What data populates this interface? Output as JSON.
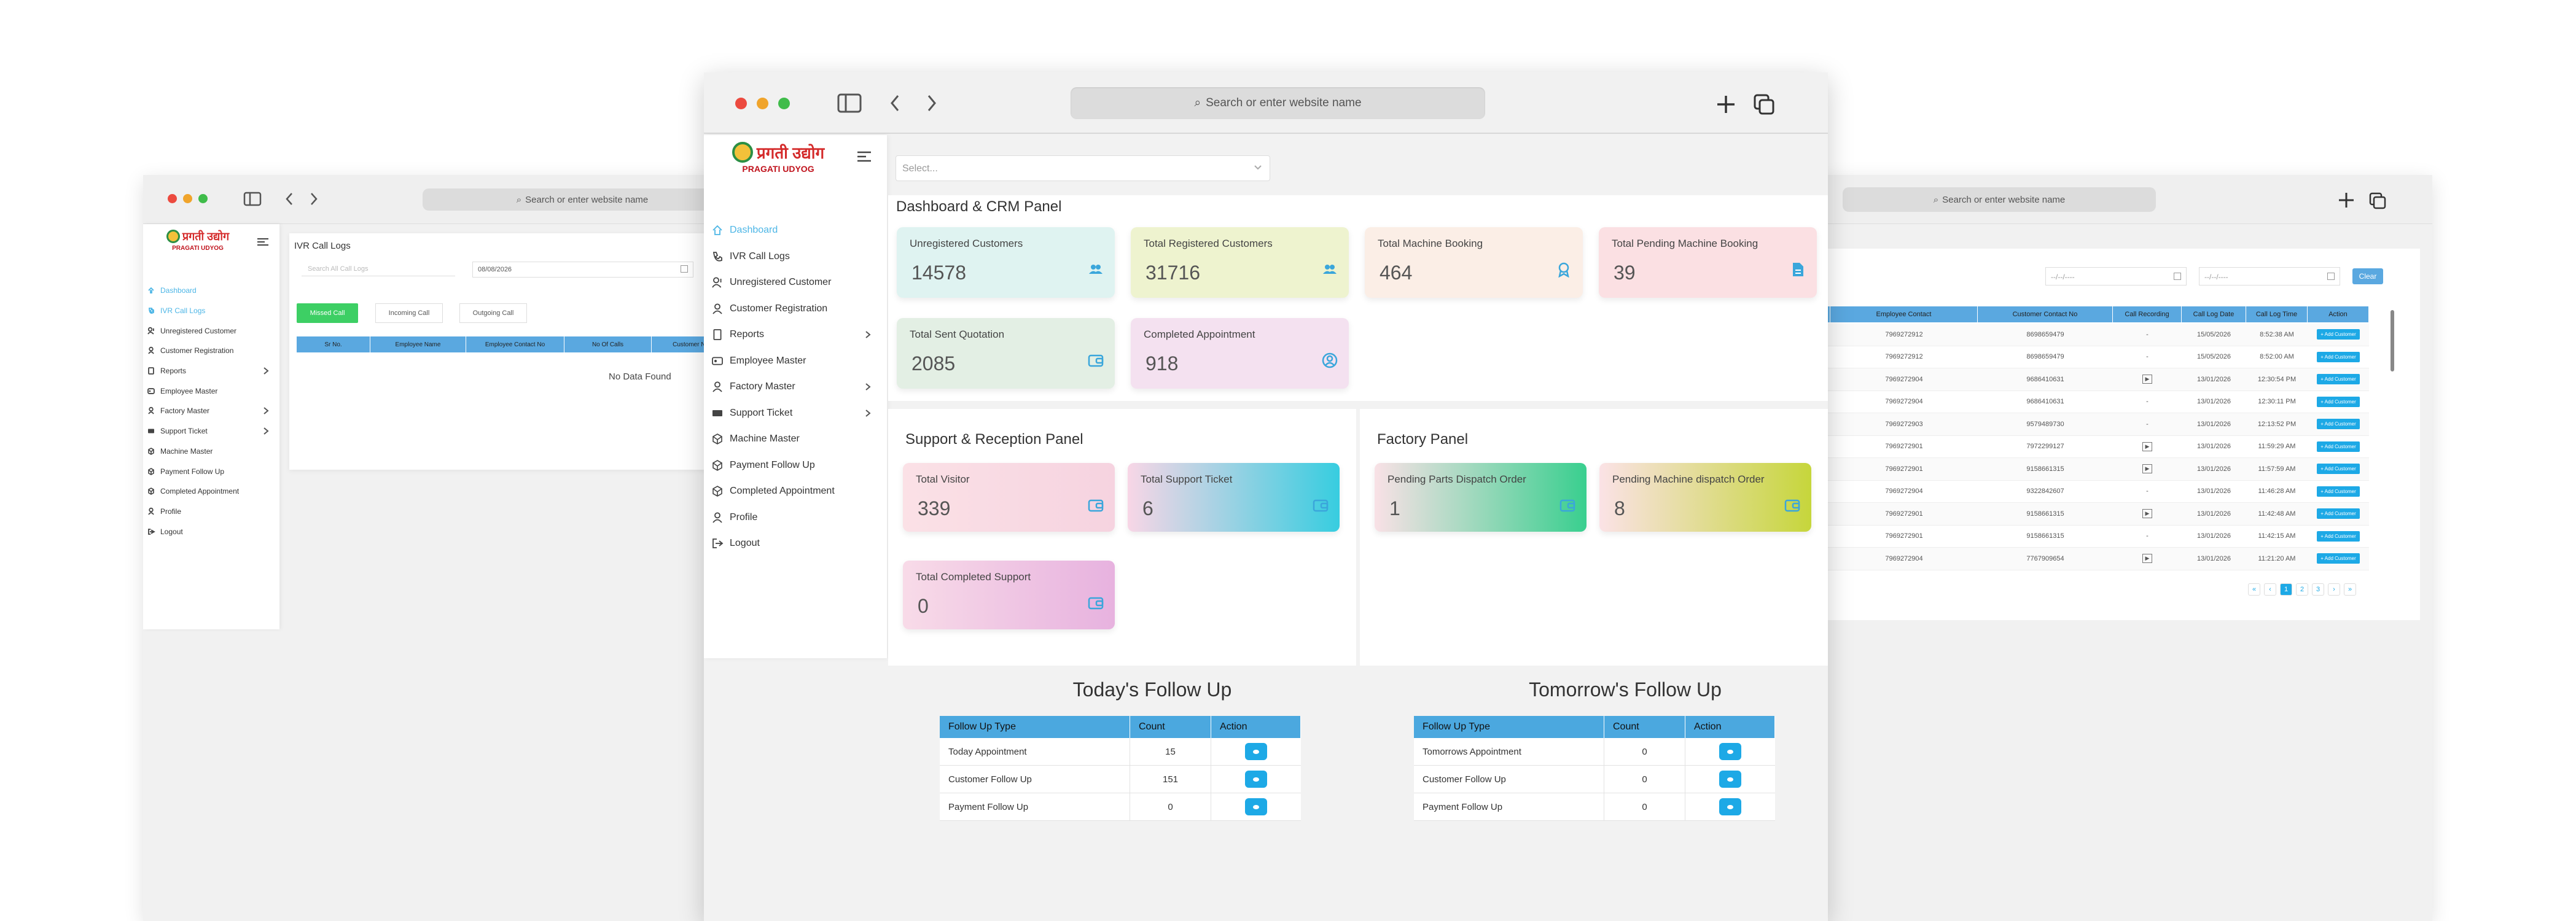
{
  "browser": {
    "url_placeholder": "Search or enter website name"
  },
  "sidebar": {
    "logo_devanagari": "प्रगती उद्योग",
    "logo_english": "PRAGATI UDYOG",
    "items": [
      {
        "label": "Dashboard",
        "icon": "home-icon"
      },
      {
        "label": "IVR Call Logs",
        "icon": "phone-icon"
      },
      {
        "label": "Unregistered Customer",
        "icon": "user-plus-icon"
      },
      {
        "label": "Customer Registration",
        "icon": "user-icon"
      },
      {
        "label": "Reports",
        "icon": "document-icon"
      },
      {
        "label": "Employee Master",
        "icon": "id-card-icon"
      },
      {
        "label": "Factory Master",
        "icon": "user-icon"
      },
      {
        "label": "Support Ticket",
        "icon": "ticket-icon"
      },
      {
        "label": "Machine Master",
        "icon": "cube-icon"
      },
      {
        "label": "Payment Follow Up",
        "icon": "cube-icon"
      },
      {
        "label": "Completed Appointment",
        "icon": "cube-icon"
      },
      {
        "label": "Profile",
        "icon": "user-icon"
      },
      {
        "label": "Logout",
        "icon": "logout-icon"
      }
    ]
  },
  "main": {
    "select_placeholder": "Select...",
    "crm_title": "Dashboard & CRM Panel",
    "crm_cards": [
      {
        "label": "Unregistered Customers",
        "value": "14578",
        "icon": "users-icon",
        "bg": "#dff3f1"
      },
      {
        "label": "Total Registered Customers",
        "value": "31716",
        "icon": "users-icon",
        "bg": "#eef3cf"
      },
      {
        "label": "Total Machine Booking",
        "value": "464",
        "icon": "award-icon",
        "bg": "#fbeee6"
      },
      {
        "label": "Total Pending Machine Booking",
        "value": "39",
        "icon": "file-icon",
        "bg": "#fbe0e3"
      },
      {
        "label": "Total Sent Quotation",
        "value": "2085",
        "icon": "wallet-icon",
        "bg": "#e3efe4"
      },
      {
        "label": "Completed Appointment",
        "value": "918",
        "icon": "user-circle-icon",
        "bg": "#f4e1f0"
      }
    ],
    "support_title": "Support & Reception Panel",
    "support_cards": [
      {
        "label": "Total Visitor",
        "value": "339"
      },
      {
        "label": "Total Support Ticket",
        "value": "6"
      },
      {
        "label": "Total Completed Support",
        "value": "0"
      }
    ],
    "factory_title": "Factory Panel",
    "factory_cards": [
      {
        "label": "Pending Parts Dispatch Order",
        "value": "1"
      },
      {
        "label": "Pending Machine dispatch Order",
        "value": "8"
      }
    ],
    "today": {
      "title": "Today's Follow Up",
      "headers": [
        "Follow Up Type",
        "Count",
        "Action"
      ],
      "rows": [
        [
          "Today Appointment",
          "15"
        ],
        [
          "Customer Follow Up",
          "151"
        ],
        [
          "Payment Follow Up",
          "0"
        ]
      ]
    },
    "tomorrow": {
      "title": "Tomorrow's Follow Up",
      "headers": [
        "Follow Up Type",
        "Count",
        "Action"
      ],
      "rows": [
        [
          "Tomorrows Appointment",
          "0"
        ],
        [
          "Customer Follow Up",
          "0"
        ],
        [
          "Payment Follow Up",
          "0"
        ]
      ]
    }
  },
  "left": {
    "page_title": "IVR Call Logs",
    "search_placeholder": "Search All Call Logs",
    "date": "08/08/2026",
    "tabs": [
      "Missed Call",
      "Incoming Call",
      "Outgoing Call"
    ],
    "headers": [
      "Sr No.",
      "Employee Name",
      "Employee Contact No",
      "No Of Calls",
      "Customer Name"
    ],
    "empty": "No Data Found"
  },
  "right": {
    "date_placeholder": "--/--/----",
    "clear": "Clear",
    "headers": [
      "Employee Contact",
      "Customer Contact No",
      "Call Recording",
      "Call Log Date",
      "Call Log Time",
      "Action"
    ],
    "add_label": "+ Add Customer",
    "rows": [
      [
        "7969272912",
        "8698659479",
        "-",
        "15/05/2026",
        "8:52:38 AM"
      ],
      [
        "7969272912",
        "8698659479",
        "-",
        "15/05/2026",
        "8:52:00 AM"
      ],
      [
        "7969272904",
        "9686410631",
        "▶",
        "13/01/2026",
        "12:30:54 PM"
      ],
      [
        "7969272904",
        "9686410631",
        "-",
        "13/01/2026",
        "12:30:11 PM"
      ],
      [
        "7969272903",
        "9579489730",
        "-",
        "13/01/2026",
        "12:13:52 PM"
      ],
      [
        "7969272901",
        "7972299127",
        "▶",
        "13/01/2026",
        "11:59:29 AM"
      ],
      [
        "7969272901",
        "9158661315",
        "▶",
        "13/01/2026",
        "11:57:59 AM"
      ],
      [
        "7969272904",
        "9322842607",
        "-",
        "13/01/2026",
        "11:46:28 AM"
      ],
      [
        "7969272901",
        "9158661315",
        "▶",
        "13/01/2026",
        "11:42:48 AM"
      ],
      [
        "7969272901",
        "9158661315",
        "-",
        "13/01/2026",
        "11:42:15 AM"
      ],
      [
        "7969272904",
        "7767909654",
        "▶",
        "13/01/2026",
        "11:21:20 AM"
      ]
    ],
    "pages": [
      "«",
      "‹",
      "1",
      "2",
      "3",
      "›",
      "»"
    ]
  }
}
